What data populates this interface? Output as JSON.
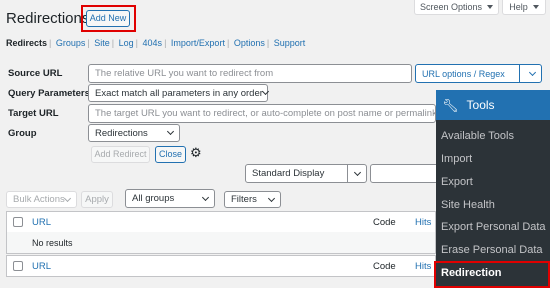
{
  "header": {
    "title": "Redirections",
    "add_new_label": "Add New",
    "screen_options_label": "Screen Options",
    "help_label": "Help"
  },
  "subnav": {
    "items": [
      "Redirects",
      "Groups",
      "Site",
      "Log",
      "404s",
      "Import/Export",
      "Options",
      "Support"
    ],
    "separator": "|"
  },
  "form": {
    "source_url_label": "Source URL",
    "source_url_placeholder": "The relative URL you want to redirect from",
    "url_options_label": "URL options / Regex",
    "query_params_label": "Query Parameters",
    "query_params_value": "Exact match all parameters in any order",
    "target_url_label": "Target URL",
    "target_url_placeholder": "The target URL you want to redirect, or auto-complete on post name or permalink.",
    "group_label": "Group",
    "group_value": "Redirections",
    "add_redirect_label": "Add Redirect",
    "close_label": "Close"
  },
  "toolbar": {
    "display_value": "Standard Display",
    "bulk_actions_value": "Bulk Actions",
    "apply_label": "Apply",
    "groups_filter_value": "All groups",
    "filters_label": "Filters"
  },
  "table": {
    "columns": {
      "url": "URL",
      "code": "Code",
      "hits": "Hits"
    },
    "empty_text": "No results"
  },
  "tools_menu": {
    "title": "Tools",
    "items": [
      "Available Tools",
      "Import",
      "Export",
      "Site Health",
      "Export Personal Data",
      "Erase Personal Data",
      "Redirection"
    ],
    "active": "Redirection"
  },
  "colors": {
    "accent": "#2271b1",
    "menu_bg": "#2c3338",
    "highlight_border": "#e00000"
  }
}
